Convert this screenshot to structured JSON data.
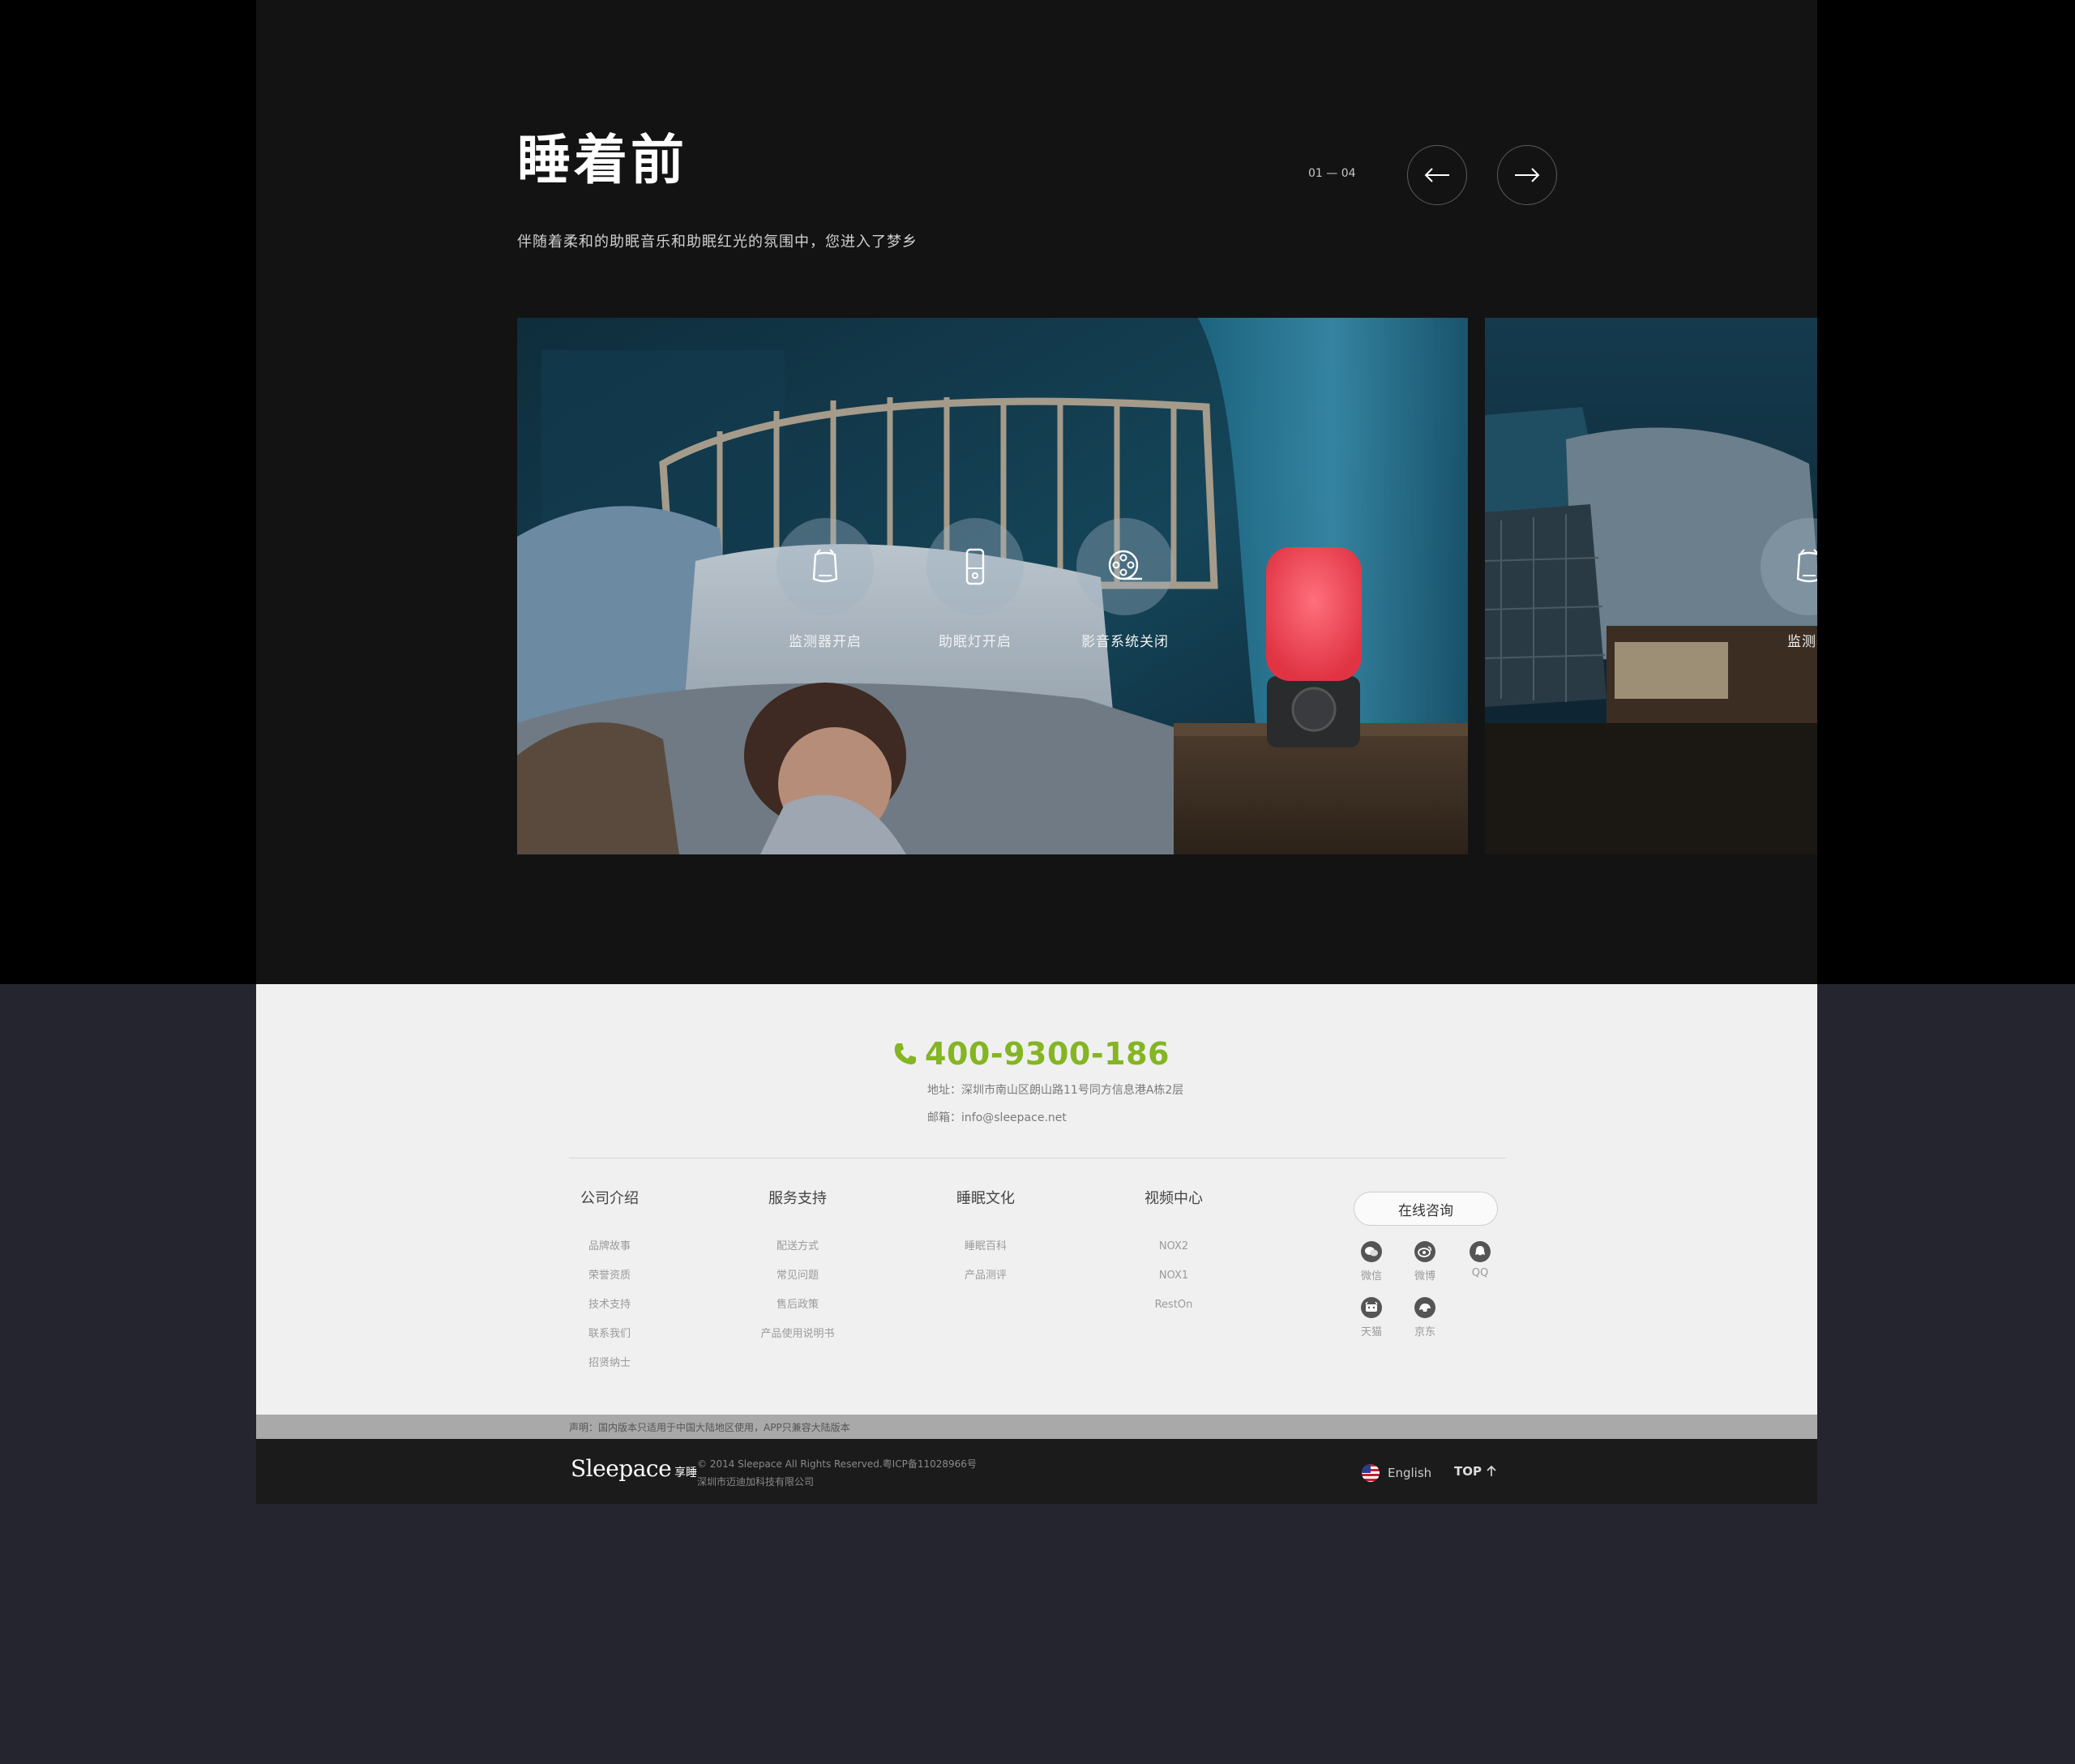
{
  "section": {
    "title": "睡着前",
    "subtitle": "伴随着柔和的助眠音乐和助眠红光的氛围中，您进入了梦乡",
    "pager": "01 — 04"
  },
  "slides": {
    "main_features": [
      {
        "label": "监测器开启",
        "icon": "monitor-device-icon"
      },
      {
        "label": "助眠灯开启",
        "icon": "sleep-lamp-icon"
      },
      {
        "label": "影音系统关闭",
        "icon": "film-reel-icon"
      }
    ],
    "next_feature_label": "监测器"
  },
  "footer": {
    "hotline": "400-9300-186",
    "address": "地址：深圳市南山区朗山路11号同方信息港A栋2层",
    "email": "邮箱：info@sleepace.net",
    "columns": [
      {
        "title": "公司介绍",
        "links": [
          "品牌故事",
          "荣誉资质",
          "技术支持",
          "联系我们",
          "招贤纳士"
        ]
      },
      {
        "title": "服务支持",
        "links": [
          "配送方式",
          "常见问题",
          "售后政策",
          "产品使用说明书"
        ]
      },
      {
        "title": "睡眠文化",
        "links": [
          "睡眠百科",
          "产品测评"
        ]
      },
      {
        "title": "视频中心",
        "links": [
          "NOX2",
          "NOX1",
          "RestOn"
        ]
      }
    ],
    "consult_label": "在线咨询",
    "social": [
      {
        "label": "微信",
        "icon": "wechat-icon"
      },
      {
        "label": "微博",
        "icon": "weibo-icon"
      },
      {
        "label": "QQ",
        "icon": "qq-icon"
      },
      {
        "label": "天猫",
        "icon": "tmall-icon"
      },
      {
        "label": "京东",
        "icon": "jd-icon"
      }
    ],
    "notice": "声明：国内版本只适用于中国大陆地区使用，APP只兼容大陆版本",
    "logo_en": "Sleepace",
    "logo_cn": "享睡",
    "copyright": "© 2014 Sleepace All Rights Reserved.粤ICP备11028966号",
    "company": "深圳市迈迪加科技有限公司",
    "language": "English",
    "top_label": "TOP"
  },
  "colors": {
    "accent_green": "#84b522",
    "stage_bg": "#131314",
    "footer_bg": "#f0f0f0",
    "lamp_red": "#e83848"
  }
}
